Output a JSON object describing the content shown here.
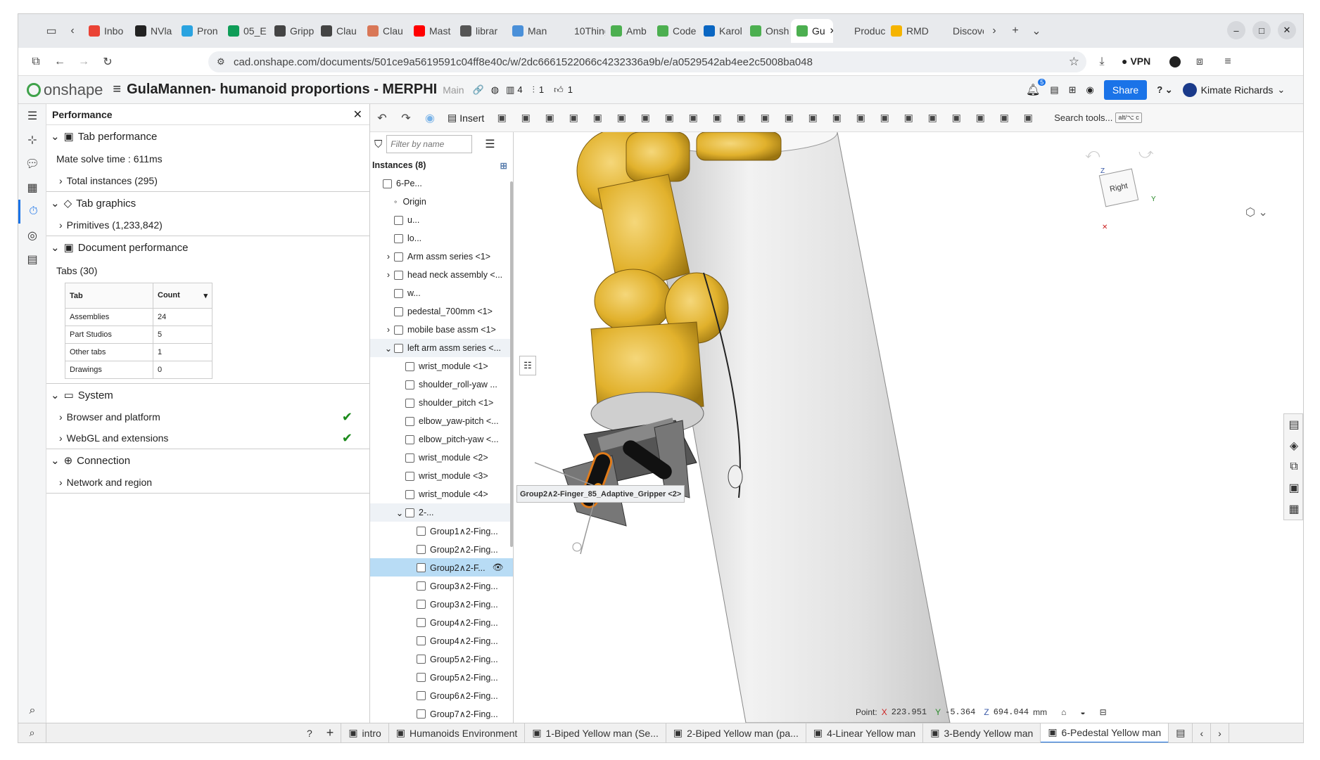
{
  "browser": {
    "tabs": [
      {
        "label": "Inbo",
        "color": "#ea4335"
      },
      {
        "label": "NVla",
        "color": "#222222"
      },
      {
        "label": "Pron",
        "color": "#2aa3e0"
      },
      {
        "label": "05_E",
        "color": "#0f9d58"
      },
      {
        "label": "Gripp",
        "color": "#444444"
      },
      {
        "label": "Clau",
        "color": "#444444"
      },
      {
        "label": "Clau",
        "color": "#d97757"
      },
      {
        "label": "Mast",
        "color": "#ff0000"
      },
      {
        "label": "librar",
        "color": "#555555"
      },
      {
        "label": "Man",
        "color": "#4a90d9"
      },
      {
        "label": "10Thing",
        "color": "#e8eaed"
      },
      {
        "label": "Amb",
        "color": "#4caf50"
      },
      {
        "label": "Code",
        "color": "#4caf50"
      },
      {
        "label": "Karol",
        "color": "#0a66c2"
      },
      {
        "label": "Onsh",
        "color": "#4caf50"
      },
      {
        "label": "Gu",
        "color": "#4caf50",
        "active": true
      },
      {
        "label": "Product",
        "color": "#e8eaed"
      },
      {
        "label": "RMD",
        "color": "#f5b400"
      },
      {
        "label": "Discover",
        "color": "#e8eaed"
      }
    ],
    "url": "cad.onshape.com/documents/501ce9a5619591c04ff8e40c/w/2dc6661522066c4232336a9b/e/a0529542ab4ee2c5008ba048",
    "vpn_label": "VPN"
  },
  "app": {
    "logo_text": "onshape",
    "doc_title": "GulaMannen- humanoid proportions - MERPHI",
    "branch": "Main",
    "versions_count": "4",
    "followers_count": "1",
    "likes_count": "1",
    "notif_count": "5",
    "share_label": "Share",
    "user_name": "Kimate Richards",
    "insert_label": "Insert",
    "search_tools": "Search tools...",
    "search_shortcut": "alt/⌥ c"
  },
  "perf": {
    "title": "Performance",
    "tab_perf": "Tab performance",
    "mate_solve": "Mate solve time : 611ms",
    "total_instances": "Total instances (295)",
    "tab_graphics": "Tab graphics",
    "primitives": "Primitives (1,233,842)",
    "doc_perf": "Document performance",
    "tabs_count": "Tabs (30)",
    "table_head": [
      "Tab",
      "Count"
    ],
    "table_rows": [
      [
        "Assemblies",
        "24"
      ],
      [
        "Part Studios",
        "5"
      ],
      [
        "Other tabs",
        "1"
      ],
      [
        "Drawings",
        "0"
      ]
    ],
    "system": "System",
    "browser_platform": "Browser and platform",
    "webgl": "WebGL and extensions",
    "connection": "Connection",
    "network": "Network and region"
  },
  "instances": {
    "filter_placeholder": "Filter by name",
    "header": "Instances (8)",
    "rows": [
      {
        "label": "6-Pe...",
        "indent": 0,
        "exp": ""
      },
      {
        "label": "Origin",
        "indent": 1,
        "exp": "",
        "origin": true
      },
      {
        "label": "u...",
        "indent": 1,
        "exp": ""
      },
      {
        "label": "lo...",
        "indent": 1,
        "exp": ""
      },
      {
        "label": "Arm assm series <1>",
        "indent": 1,
        "exp": "›"
      },
      {
        "label": "head neck assembly <...",
        "indent": 1,
        "exp": "›"
      },
      {
        "label": "w...",
        "indent": 1,
        "exp": ""
      },
      {
        "label": "pedestal_700mm <1>",
        "indent": 1,
        "exp": ""
      },
      {
        "label": "mobile base assm <1>",
        "indent": 1,
        "exp": "›"
      },
      {
        "label": "left arm assm series <...",
        "indent": 1,
        "exp": "⌄",
        "hl": true
      },
      {
        "label": "wrist_module <1>",
        "indent": 2,
        "exp": ""
      },
      {
        "label": "shoulder_roll-yaw ...",
        "indent": 2,
        "exp": ""
      },
      {
        "label": "shoulder_pitch <1>",
        "indent": 2,
        "exp": ""
      },
      {
        "label": "elbow_yaw-pitch <...",
        "indent": 2,
        "exp": ""
      },
      {
        "label": "elbow_pitch-yaw <...",
        "indent": 2,
        "exp": ""
      },
      {
        "label": "wrist_module <2>",
        "indent": 2,
        "exp": ""
      },
      {
        "label": "wrist_module <3>",
        "indent": 2,
        "exp": ""
      },
      {
        "label": "wrist_module <4>",
        "indent": 2,
        "exp": ""
      },
      {
        "label": "2-...",
        "indent": 2,
        "exp": "⌄",
        "hl": true
      },
      {
        "label": "Group1∧2-Fing...",
        "indent": 3,
        "exp": ""
      },
      {
        "label": "Group2∧2-Fing...",
        "indent": 3,
        "exp": ""
      },
      {
        "label": "Group2∧2-F...",
        "indent": 3,
        "exp": "",
        "sel": true
      },
      {
        "label": "Group3∧2-Fing...",
        "indent": 3,
        "exp": ""
      },
      {
        "label": "Group3∧2-Fing...",
        "indent": 3,
        "exp": ""
      },
      {
        "label": "Group4∧2-Fing...",
        "indent": 3,
        "exp": ""
      },
      {
        "label": "Group4∧2-Fing...",
        "indent": 3,
        "exp": ""
      },
      {
        "label": "Group5∧2-Fing...",
        "indent": 3,
        "exp": ""
      },
      {
        "label": "Group5∧2-Fing...",
        "indent": 3,
        "exp": ""
      },
      {
        "label": "Group6∧2-Fing...",
        "indent": 3,
        "exp": ""
      },
      {
        "label": "Group7∧2-Fing...",
        "indent": 3,
        "exp": ""
      }
    ],
    "tooltip": "Group2∧2-Finger_85_Adaptive_Gripper <2>"
  },
  "viewport": {
    "cube_label": "Right",
    "axis_z": "Z",
    "axis_y": "Y",
    "point_label": "Point:",
    "x_label": "X",
    "x_val": "223.951",
    "y_label": "Y",
    "y_val": "-5.364",
    "z_label": "Z",
    "z_val": "694.044",
    "unit": "mm",
    "gold": "#e3b52f",
    "pedestal": "#e9e9e9"
  },
  "bottom_tabs": [
    {
      "label": "intro"
    },
    {
      "label": "Humanoids Environment"
    },
    {
      "label": "1-Biped Yellow man (Se..."
    },
    {
      "label": "2-Biped Yellow man (pa..."
    },
    {
      "label": "4-Linear Yellow man"
    },
    {
      "label": "3-Bendy Yellow man"
    },
    {
      "label": "6-Pedestal Yellow man",
      "active": true
    }
  ]
}
